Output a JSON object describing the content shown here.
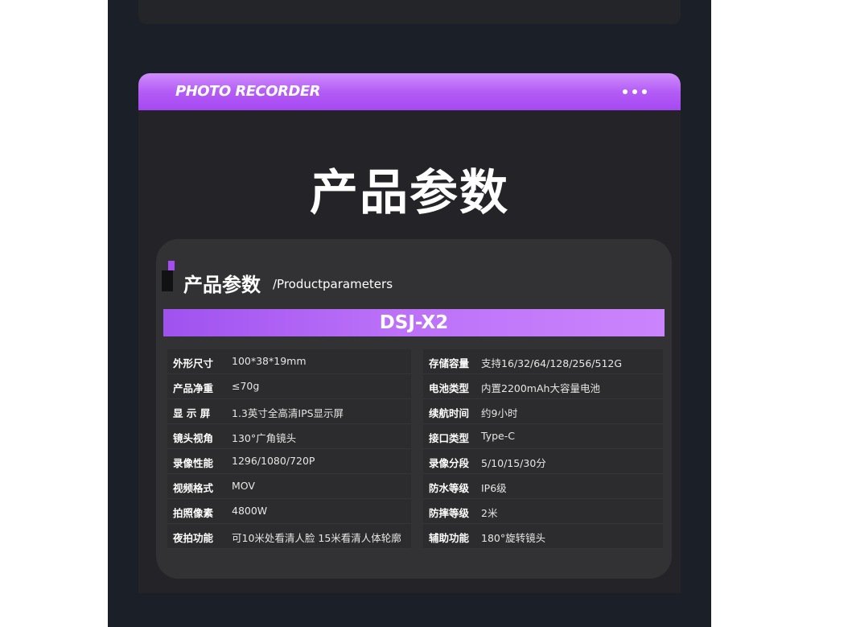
{
  "header": {
    "title": "PHOTO RECORDER"
  },
  "main_title": "产品参数",
  "panel": {
    "title": "产品参数",
    "subtitle": "/Productparameters",
    "model": "DSJ-X2"
  },
  "specs_left": [
    {
      "label": "外形尺寸",
      "value": "100*38*19mm"
    },
    {
      "label": "产品净重",
      "value": "≤70g"
    },
    {
      "label": "显 示 屏",
      "value": "1.3英寸全高清IPS显示屏"
    },
    {
      "label": "镜头视角",
      "value": "130°广角镜头"
    },
    {
      "label": "录像性能",
      "value": "1296/1080/720P"
    },
    {
      "label": "视频格式",
      "value": "MOV"
    },
    {
      "label": "拍照像素",
      "value": "4800W"
    },
    {
      "label": "夜拍功能",
      "value": "可10米处看清人脸 15米看清人体轮廓"
    }
  ],
  "specs_right": [
    {
      "label": "存储容量",
      "value": "支持16/32/64/128/256/512G"
    },
    {
      "label": "电池类型",
      "value": "内置2200mAh大容量电池"
    },
    {
      "label": "续航时间",
      "value": "约9小时"
    },
    {
      "label": "接口类型",
      "value": "Type-C"
    },
    {
      "label": "录像分段",
      "value": "5/10/15/30分"
    },
    {
      "label": "防水等级",
      "value": "IP6级"
    },
    {
      "label": "防摔等级",
      "value": "2米"
    },
    {
      "label": "辅助功能",
      "value": "180°旋转镜头"
    }
  ],
  "colors": {
    "accent": "#b45cf6",
    "background": "#1b1f28",
    "card": "#242428",
    "panel": "#323234"
  }
}
